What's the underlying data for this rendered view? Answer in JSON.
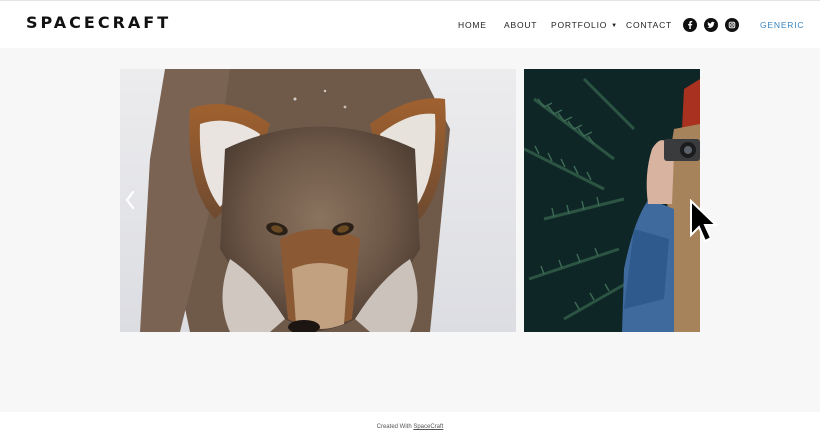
{
  "header": {
    "logo": "SPACECRAFT",
    "nav": {
      "home": "HOME",
      "about": "ABOUT",
      "portfolio": "PORTFOLIO",
      "contact": "CONTACT",
      "generic": "GENERIC"
    },
    "social_icons": [
      "facebook-icon",
      "twitter-icon",
      "instagram-icon"
    ],
    "accent_color": "#3a86c4"
  },
  "gallery": {
    "slides": [
      {
        "subject": "coyote-photo"
      },
      {
        "subject": "photographer-photo"
      }
    ]
  },
  "footer": {
    "prefix": "Created With",
    "link": "SpaceCraft"
  }
}
